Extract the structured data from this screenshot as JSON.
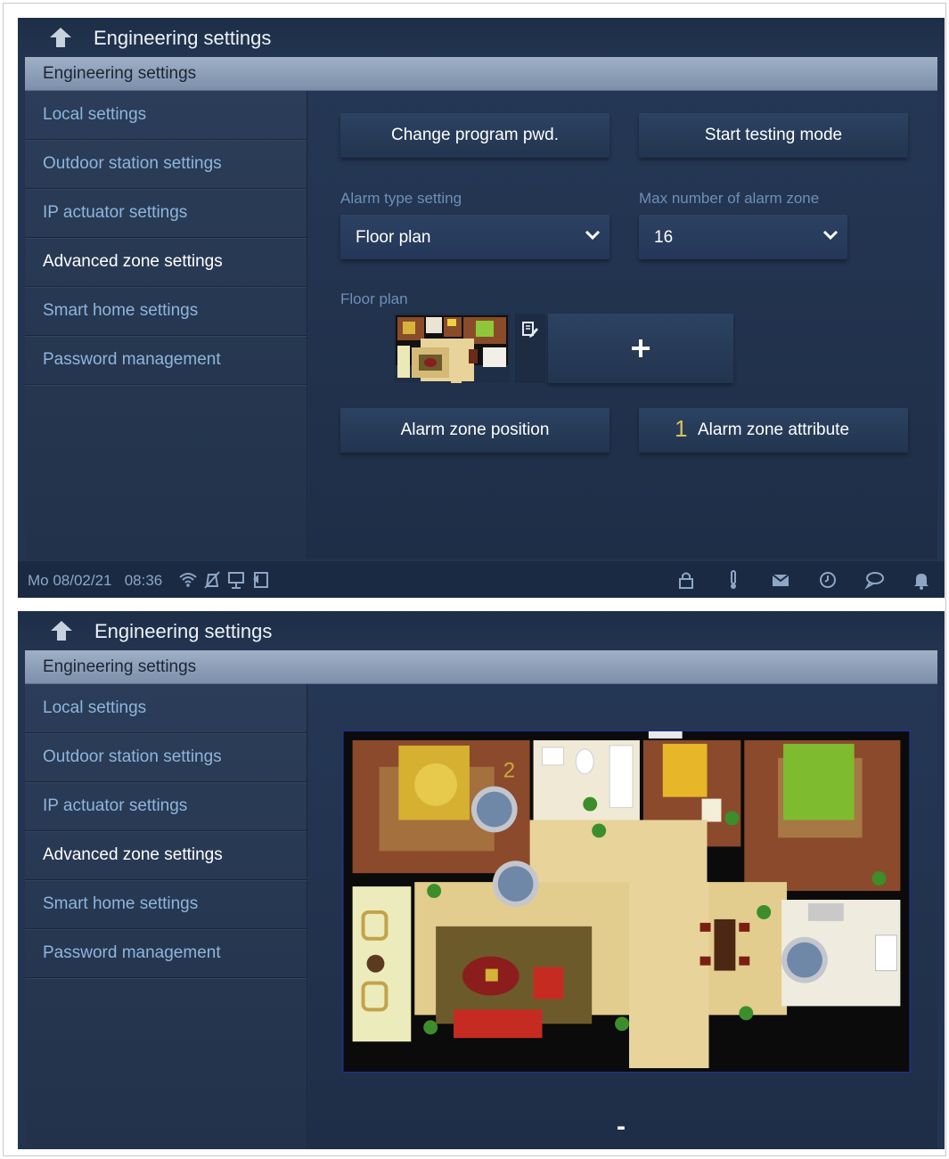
{
  "header": {
    "title": "Engineering settings",
    "back_icon": "back-arrow-icon"
  },
  "breadcrumb": "Engineering settings",
  "sidebar": {
    "items": [
      {
        "label": "Local settings",
        "active": false
      },
      {
        "label": "Outdoor station settings",
        "active": false
      },
      {
        "label": "IP actuator settings",
        "active": false
      },
      {
        "label": "Advanced zone settings",
        "active": true
      },
      {
        "label": "Smart home settings",
        "active": false
      },
      {
        "label": "Password management",
        "active": false
      }
    ]
  },
  "main": {
    "change_pwd_label": "Change program pwd.",
    "testing_mode_label": "Start testing mode",
    "alarm_type": {
      "label": "Alarm type setting",
      "value": "Floor plan"
    },
    "max_zone": {
      "label": "Max number of alarm zone",
      "value": "16"
    },
    "floor_plan_label": "Floor plan",
    "add_symbol": "+",
    "zone_position_label": "Alarm zone position",
    "zone_attribute_label": "Alarm zone attribute",
    "zone_attribute_count": "1"
  },
  "statusbar": {
    "date": "Mo 08/02/21",
    "time": "08:36",
    "left_icons": [
      "wifi-icon",
      "mute-icon",
      "screen-icon",
      "exit-icon"
    ],
    "right_icons": [
      "lock-icon",
      "thermometer-icon",
      "mail-icon",
      "history-icon",
      "message-icon",
      "bell-icon"
    ]
  },
  "floorplan_view": {
    "zone_marker_label": "2",
    "minus_label": "-"
  },
  "colors": {
    "background": "#223450",
    "accent_text": "#8fb5dd",
    "label_text": "#6f8fb5",
    "count_yellow": "#d7c25a"
  }
}
